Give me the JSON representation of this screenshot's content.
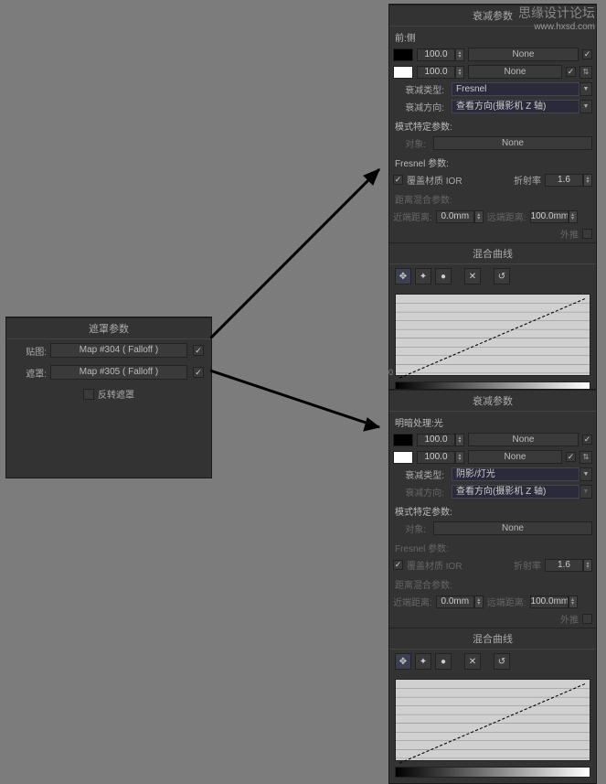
{
  "watermark": {
    "line1": "思缘设计论坛",
    "line2": "www.hxsd.com"
  },
  "mask": {
    "title": "遮罩参数",
    "map_label": "贴图:",
    "map_btn": "Map #304  ( Falloff )",
    "mask_label": "遮罩:",
    "mask_btn": "Map #305  ( Falloff )",
    "invert": "反转遮罩"
  },
  "top": {
    "rollup_falloff": "衰减参数",
    "front_side": "前:侧",
    "v1": "100.0",
    "v2": "100.0",
    "none": "None",
    "type_label": "衰减类型:",
    "type_value": "Fresnel",
    "dir_label": "衰减方向:",
    "dir_value": "查看方向(摄影机 Z 轴)",
    "mode_section": "模式特定参数:",
    "object_label": "对象:",
    "fresnel_section": "Fresnel 参数:",
    "override_ior": "覆盖材质 IOR",
    "ior_label": "折射率",
    "ior_value": "1.6",
    "dist_section": "距离混合参数:",
    "near_label": "近端距离:",
    "near_value": "0.0mm",
    "far_label": "远端距离:",
    "far_value": "100.0mm",
    "extrap": "外推",
    "rollup_curve": "混合曲线",
    "curve_y0": "0"
  },
  "bottom": {
    "rollup_falloff": "衰减参数",
    "light_label": "明暗处理:光",
    "v1": "100.0",
    "v2": "100.0",
    "none": "None",
    "type_label": "衰减类型:",
    "type_value": "阴影/灯光",
    "dir_label": "衰减方向:",
    "dir_value": "查看方向(摄影机 Z 轴)",
    "mode_section": "模式特定参数:",
    "object_label": "对象:",
    "fresnel_section": "Fresnel 参数:",
    "override_ior": "覆盖材质 IOR",
    "ior_label": "折射率",
    "ior_value": "1.6",
    "dist_section": "距离混合参数:",
    "near_label": "近端距离:",
    "near_value": "0.0mm",
    "far_label": "远端距离:",
    "far_value": "100.0mm",
    "extrap": "外推",
    "rollup_curve": "混合曲线"
  }
}
